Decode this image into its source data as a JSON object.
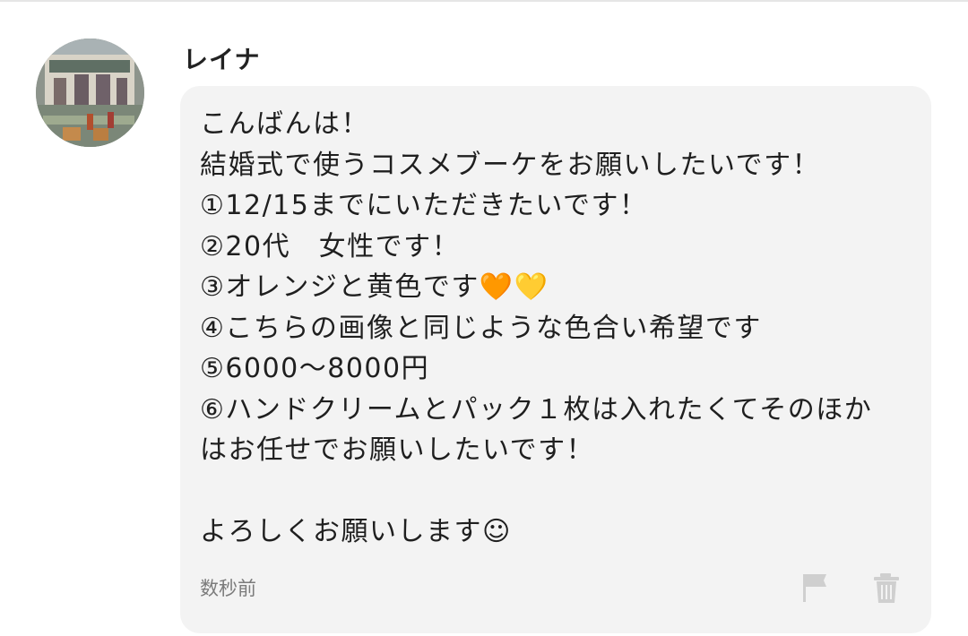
{
  "message": {
    "sender_name": "レイナ",
    "avatar_icon": "profile-photo-avatar",
    "lines": [
      "こんばんは！",
      "結婚式で使うコスメブーケをお願いしたいです！",
      "①12/15までにいただきたいです！",
      "②20代　女性です！",
      "③オレンジと黄色です🧡💛",
      "④こちらの画像と同じような色合い希望です",
      "⑤6000～8000円",
      "⑥ハンドクリームとパック１枚は入れたくてそのほか",
      "はお任せでお願いしたいです！",
      "",
      "よろしくお願いします☺"
    ],
    "timestamp": "数秒前"
  },
  "actions": {
    "flag_icon": "flag-icon",
    "trash_icon": "trash-icon"
  },
  "colors": {
    "bubble_background": "#f3f3f3",
    "timestamp_text": "#7b7b7b",
    "icon_gray": "#cfcfcf"
  }
}
